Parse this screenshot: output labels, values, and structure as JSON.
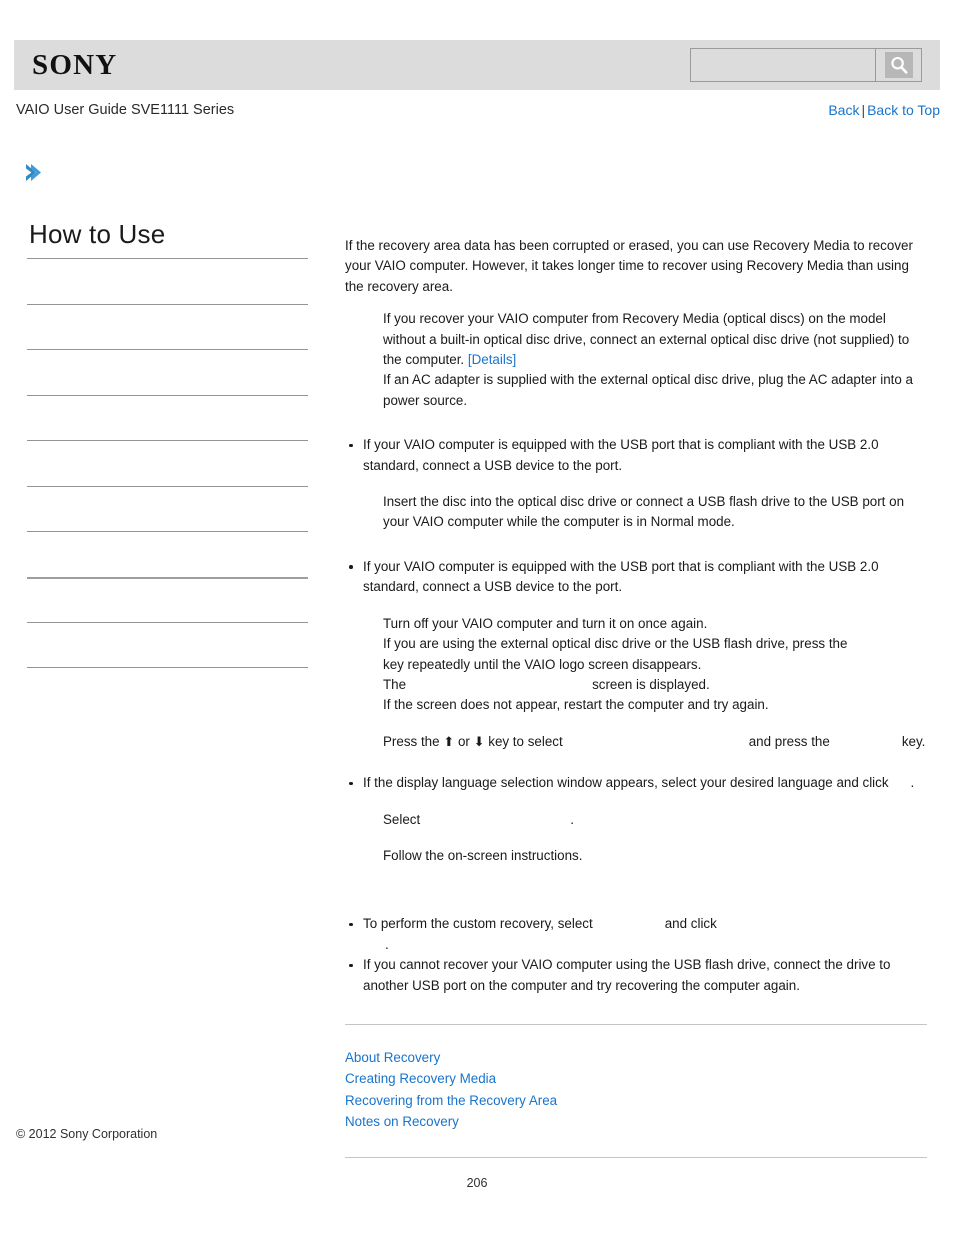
{
  "header": {
    "logo_text": "SONY",
    "search": {
      "value": "",
      "placeholder": "",
      "icon": "search-icon"
    }
  },
  "subheader": {
    "guide_title": "VAIO User Guide SVE1111 Series",
    "nav": {
      "back_label": "Back",
      "separator": "|",
      "back_to_top_label": "Back to Top"
    }
  },
  "sidebar": {
    "expand_icon": "chevron-right-icon",
    "title": "How to Use",
    "items": [
      {
        "label": ""
      },
      {
        "label": ""
      },
      {
        "label": ""
      },
      {
        "label": ""
      },
      {
        "label": ""
      },
      {
        "label": ""
      },
      {
        "label": ""
      },
      {
        "label": ""
      },
      {
        "label": ""
      }
    ]
  },
  "main": {
    "intro": "If the recovery area data has been corrupted or erased, you can use Recovery Media to recover your VAIO computer. However, it takes longer time to recover using Recovery Media than using the recovery area.",
    "step_optical_drive_a": "If you recover your VAIO computer from Recovery Media (optical discs) on the model without a built-in optical disc drive, connect an external optical disc drive (not supplied) to the computer.",
    "details_link": "[Details]",
    "step_optical_drive_b": "If an AC adapter is supplied with the external optical disc drive, plug the AC adapter into a power source.",
    "note_usb_1": "If your VAIO computer is equipped with the USB port that is compliant with the USB 2.0 standard, connect a USB device to the port.",
    "step_insert_disc": "Insert the disc into the optical disc drive or connect a USB flash drive to the USB port on your VAIO computer while the computer is in Normal mode.",
    "note_usb_2": "If your VAIO computer is equipped with the USB port that is compliant with the USB 2.0 standard, connect a USB device to the port.",
    "step_turn_off": "Turn off your VAIO computer and turn it on once again.",
    "step_press_key_a": "If you are using the external optical disc drive or the USB flash drive, press the",
    "step_press_key_b": "key repeatedly until the VAIO logo screen disappears.",
    "step_screen_a": "The",
    "step_screen_b": "screen is displayed.",
    "step_screen_retry": "If the screen does not appear, restart the computer and try again.",
    "step_select_a": "Press the",
    "step_select_arrow_up": "⬆",
    "step_select_or": "or",
    "step_select_arrow_down": "⬇",
    "step_select_b": "key to select",
    "step_select_c": "and press the",
    "step_select_d": "key.",
    "note_language_a": "If the display language selection window appears, select your desired language and click",
    "note_language_b": ".",
    "step_select_label": "Select",
    "step_select_period": ".",
    "step_follow": "Follow the on-screen instructions.",
    "hint_custom_a": "To perform the custom recovery, select",
    "hint_custom_b": "and click",
    "hint_custom_c": ".",
    "hint_usb": "If you cannot recover your VAIO computer using the USB flash drive, connect the drive to another USB port on the computer and try recovering the computer again."
  },
  "related_topics": [
    {
      "label": "About Recovery"
    },
    {
      "label": "Creating Recovery Media"
    },
    {
      "label": "Recovering from the Recovery Area"
    },
    {
      "label": "Notes on Recovery"
    }
  ],
  "footer": {
    "copyright": "© 2012 Sony Corporation",
    "page_number": "206"
  },
  "colors": {
    "link_blue": "#1874CD",
    "header_gray": "#dcdcdc",
    "chevron_blue": "#2E8BC8"
  }
}
